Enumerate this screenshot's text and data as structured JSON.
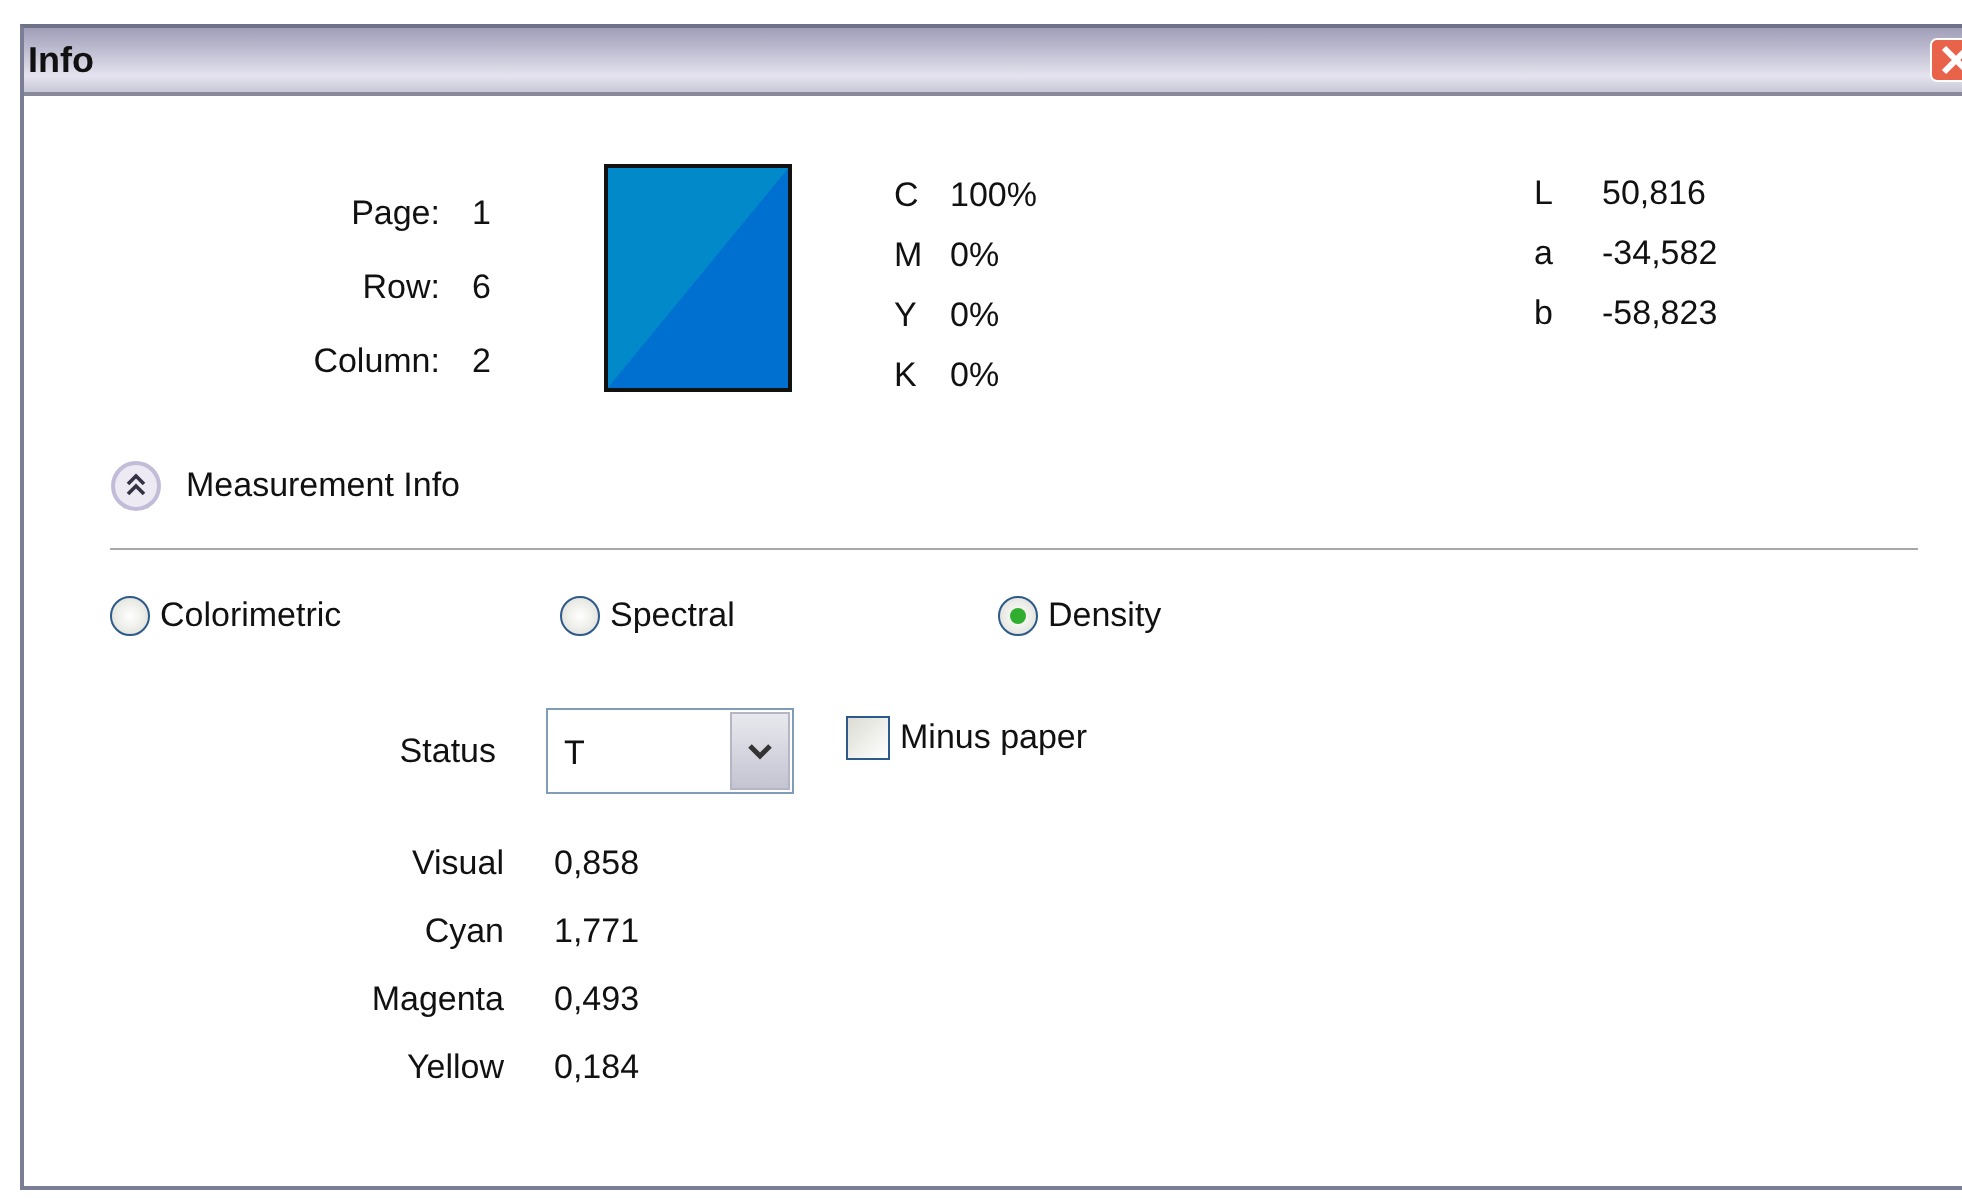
{
  "window": {
    "title": "Info"
  },
  "position": [
    {
      "label": "Page:",
      "value": "1"
    },
    {
      "label": "Row:",
      "value": "6"
    },
    {
      "label": "Column:",
      "value": "2"
    }
  ],
  "cmyk": [
    {
      "label": "C",
      "value": "100%"
    },
    {
      "label": "M",
      "value": "0%"
    },
    {
      "label": "Y",
      "value": "0%"
    },
    {
      "label": "K",
      "value": "0%"
    }
  ],
  "lab": [
    {
      "label": "L",
      "value": "50,816"
    },
    {
      "label": "a",
      "value": "-34,582"
    },
    {
      "label": "b",
      "value": "-58,823"
    }
  ],
  "measurement_info": {
    "label": "Measurement Info",
    "expanded": true
  },
  "modes": [
    {
      "label": "Colorimetric",
      "selected": false
    },
    {
      "label": "Spectral",
      "selected": false
    },
    {
      "label": "Density",
      "selected": true
    }
  ],
  "status": {
    "label": "Status",
    "value": "T"
  },
  "minus_paper": {
    "label": "Minus paper",
    "checked": false
  },
  "densities": [
    {
      "label": "Visual",
      "value": "0,858"
    },
    {
      "label": "Cyan",
      "value": "1,771"
    },
    {
      "label": "Magenta",
      "value": "0,493"
    },
    {
      "label": "Yellow",
      "value": "0,184"
    }
  ]
}
